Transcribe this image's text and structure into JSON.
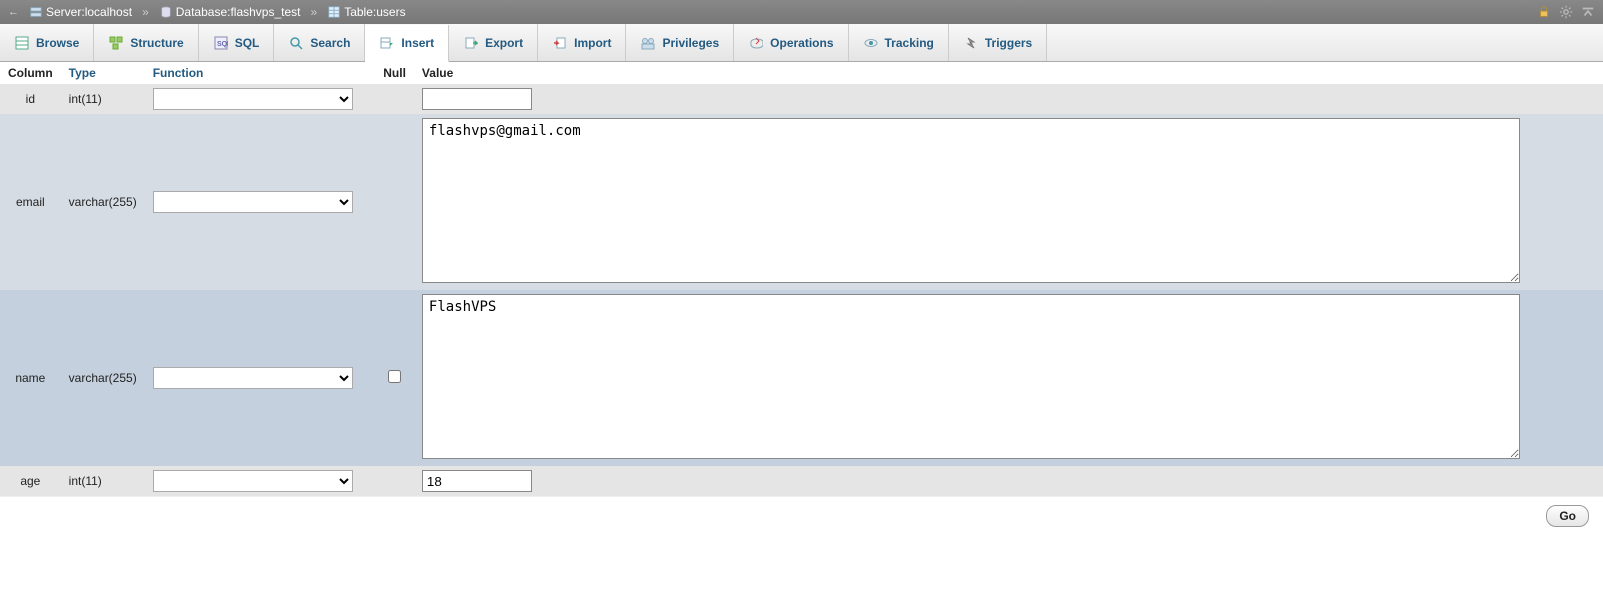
{
  "breadcrumb": {
    "server_label": "Server: ",
    "server_value": "localhost",
    "database_label": "Database: ",
    "database_value": "flashvps_test",
    "table_label": "Table: ",
    "table_value": "users"
  },
  "tabs": [
    {
      "label": "Browse"
    },
    {
      "label": "Structure"
    },
    {
      "label": "SQL"
    },
    {
      "label": "Search"
    },
    {
      "label": "Insert"
    },
    {
      "label": "Export"
    },
    {
      "label": "Import"
    },
    {
      "label": "Privileges"
    },
    {
      "label": "Operations"
    },
    {
      "label": "Tracking"
    },
    {
      "label": "Triggers"
    }
  ],
  "headers": {
    "column": "Column",
    "type": "Type",
    "function": "Function",
    "null": "Null",
    "value": "Value"
  },
  "rows": [
    {
      "column": "id",
      "type": "int(11)",
      "null_checkbox": false,
      "value": "",
      "textarea": false
    },
    {
      "column": "email",
      "type": "varchar(255)",
      "null_checkbox": false,
      "value": "flashvps@gmail.com",
      "textarea": true
    },
    {
      "column": "name",
      "type": "varchar(255)",
      "null_checkbox": true,
      "null_checked": false,
      "value": "FlashVPS",
      "textarea": true
    },
    {
      "column": "age",
      "type": "int(11)",
      "null_checkbox": false,
      "value": "18",
      "textarea": false
    }
  ],
  "go_label": "Go"
}
